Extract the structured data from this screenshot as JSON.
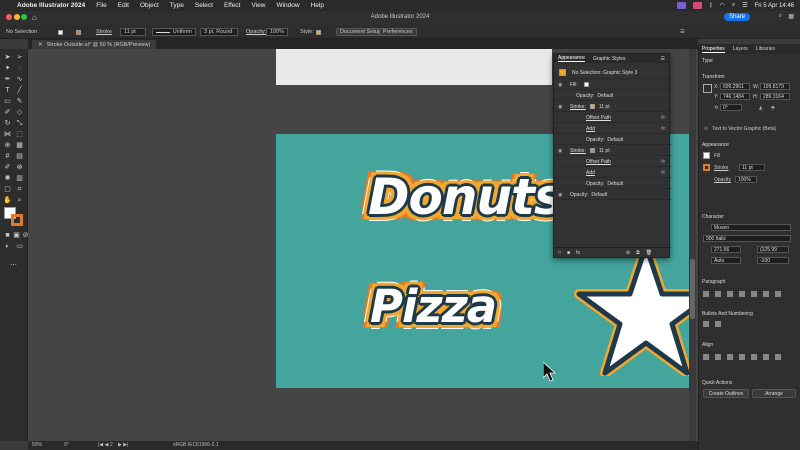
{
  "menubar": {
    "app_name": "Adobe Illustrator 2024",
    "items": [
      "File",
      "Edit",
      "Object",
      "Type",
      "Select",
      "Effect",
      "View",
      "Window",
      "Help"
    ],
    "clock": "Fri 5 Apr  14:46"
  },
  "titlebar": {
    "title": "Adobe Illustrator 2024",
    "share_label": "Share"
  },
  "controlbar": {
    "selection": "No Selection",
    "stroke_label": "Stroke",
    "stroke_value": "11 pt",
    "profile_value": "Uniform",
    "brush_value": "3 pt. Round",
    "opacity_label": "Opacity:",
    "opacity_value": "100%",
    "style_label": "Style:",
    "document_setup": "Document Setup",
    "preferences": "Preferences"
  },
  "doc_tab": {
    "label": "Stroke Outside.ai* @ 50 % (RGB/Preview)"
  },
  "artboard": {
    "donuts": "Donuts",
    "pizza": "Pizza",
    "colors": {
      "bg": "#43a59c",
      "orange": "#f0a830"
    }
  },
  "statusbar": {
    "zoom": "50%",
    "rotate": "0°",
    "artboard": "2",
    "profile": "sRGB IEC61966-2.1"
  },
  "appearance_panel": {
    "tabs": [
      "Appearance",
      "Graphic Styles"
    ],
    "header": "No Selection: Graphic Style 3",
    "rows": [
      {
        "label": "Fill:",
        "kind": "fill"
      },
      {
        "label": "Opacity:",
        "value": "Default"
      },
      {
        "label": "Stroke:",
        "value": "11 pt"
      },
      {
        "label": "Offset Path"
      },
      {
        "label": "Add"
      },
      {
        "label": "Opacity:",
        "value": "Default"
      },
      {
        "label": "Stroke:",
        "value": "11 pt"
      },
      {
        "label": "Offset Path"
      },
      {
        "label": "Add"
      },
      {
        "label": "Opacity:",
        "value": "Default"
      },
      {
        "label": "Opacity:",
        "value": "Default"
      }
    ]
  },
  "properties_panel": {
    "tabs": [
      "Properties",
      "Layers",
      "Libraries"
    ],
    "type_label": "Type",
    "transform_label": "Transform",
    "x_label": "X:",
    "x_value": "699.2961",
    "y_label": "Y:",
    "y_value": "746.1484",
    "w_label": "W:",
    "w_value": "199.8179",
    "h_label": "H:",
    "h_value": "289.3164",
    "angle_value": "0°",
    "text_to_vector": "Text to Vector Graphic (Beta)",
    "appearance_label": "Appearance",
    "fill_label": "Fill",
    "stroke_label": "Stroke",
    "stroke_value": "11 pt",
    "opacity_label": "Opacity",
    "opacity_value": "100%",
    "character_label": "Character",
    "font_family": "Museo",
    "font_style": "900 Italic",
    "font_size": "271.66",
    "leading": "(325.99",
    "kerning": "Auto",
    "tracking": "-100",
    "paragraph_label": "Paragraph",
    "bullets_label": "Bullets And Numbering",
    "align_label": "Align",
    "quick_actions_label": "Quick Actions",
    "create_outlines": "Create Outlines",
    "arrange": "Arrange"
  }
}
